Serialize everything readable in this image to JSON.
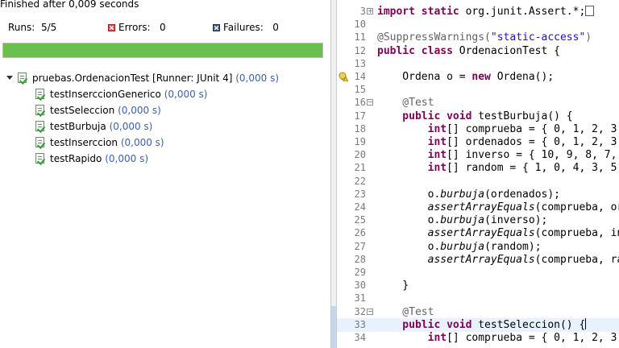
{
  "junit": {
    "status": "Finished after 0,009 seconds",
    "runs_label": "Runs:",
    "runs_value": "5/5",
    "errors_label": "Errors:",
    "errors_value": "0",
    "failures_label": "Failures:",
    "failures_value": "0",
    "progress_fraction": 1.0,
    "progress_color": "#6bbf4e",
    "suite": {
      "name": "pruebas.OrdenacionTest [Runner: JUnit 4]",
      "time": "(0,000 s)",
      "icon": "suite-success-icon"
    },
    "tests": [
      {
        "name": "testInserccionGenerico",
        "time": "(0,000 s)",
        "icon": "test-success-icon"
      },
      {
        "name": "testSeleccion",
        "time": "(0,000 s)",
        "icon": "test-success-icon"
      },
      {
        "name": "testBurbuja",
        "time": "(0,000 s)",
        "icon": "test-success-icon"
      },
      {
        "name": "testInserccion",
        "time": "(0,000 s)",
        "icon": "test-success-icon"
      },
      {
        "name": "testRapido",
        "time": "(0,000 s)",
        "icon": "test-success-icon"
      }
    ]
  },
  "editor": {
    "lines": [
      {
        "num": "3",
        "fold": "+",
        "parts": [
          [
            "kw",
            "import static"
          ],
          [
            "",
            "org.junit.Assert.*;"
          ]
        ],
        "folded_marker": true
      },
      {
        "num": "10",
        "parts": []
      },
      {
        "num": "11",
        "parts": [
          [
            "ann",
            "@SuppressWarnings("
          ],
          [
            "str",
            "\"static-access\""
          ],
          [
            "ann",
            ")"
          ]
        ]
      },
      {
        "num": "12",
        "parts": [
          [
            "kw",
            "public class"
          ],
          [
            "",
            "OrdenacionTest {"
          ]
        ]
      },
      {
        "num": "13",
        "parts": []
      },
      {
        "num": "14",
        "warning": true,
        "parts": [
          [
            "",
            "    Ordena o = "
          ],
          [
            "kw",
            "new"
          ],
          [
            "",
            " Ordena();"
          ]
        ]
      },
      {
        "num": "15",
        "parts": []
      },
      {
        "num": "16",
        "fold": "−",
        "parts": [
          [
            "ann",
            "    @Test"
          ]
        ]
      },
      {
        "num": "17",
        "parts": [
          [
            "kw",
            "    public void"
          ],
          [
            "",
            " testBurbuja() {"
          ]
        ]
      },
      {
        "num": "18",
        "parts": [
          [
            "kw",
            "        int"
          ],
          [
            "",
            "[] comprueba = { 0, 1, 2, 3,"
          ]
        ]
      },
      {
        "num": "19",
        "parts": [
          [
            "kw",
            "        int"
          ],
          [
            "",
            "[] ordenados = { 0, 1, 2, 3,"
          ]
        ]
      },
      {
        "num": "20",
        "parts": [
          [
            "kw",
            "        int"
          ],
          [
            "",
            "[] inverso = { 10, 9, 8, 7,"
          ]
        ]
      },
      {
        "num": "21",
        "parts": [
          [
            "kw",
            "        int"
          ],
          [
            "",
            "[] random = { 1, 0, 4, 3, 5,"
          ]
        ]
      },
      {
        "num": "22",
        "parts": []
      },
      {
        "num": "23",
        "parts": [
          [
            "",
            "        o."
          ],
          [
            "it",
            "burbuja"
          ],
          [
            "",
            "(ordenados);"
          ]
        ]
      },
      {
        "num": "24",
        "parts": [
          [
            "it",
            "        assertArrayEquals"
          ],
          [
            "",
            "(comprueba, or"
          ]
        ]
      },
      {
        "num": "25",
        "parts": [
          [
            "",
            "        o."
          ],
          [
            "it",
            "burbuja"
          ],
          [
            "",
            "(inverso);"
          ]
        ]
      },
      {
        "num": "26",
        "parts": [
          [
            "it",
            "        assertArrayEquals"
          ],
          [
            "",
            "(comprueba, in"
          ]
        ]
      },
      {
        "num": "27",
        "parts": [
          [
            "",
            "        o."
          ],
          [
            "it",
            "burbuja"
          ],
          [
            "",
            "(random);"
          ]
        ]
      },
      {
        "num": "28",
        "parts": [
          [
            "it",
            "        assertArrayEquals"
          ],
          [
            "",
            "(comprueba, ra"
          ]
        ]
      },
      {
        "num": "29",
        "parts": []
      },
      {
        "num": "30",
        "parts": [
          [
            "",
            "    }"
          ]
        ]
      },
      {
        "num": "31",
        "parts": []
      },
      {
        "num": "32",
        "fold": "−",
        "parts": [
          [
            "ann",
            "    @Test"
          ]
        ]
      },
      {
        "num": "33",
        "current": true,
        "cursor": true,
        "parts": [
          [
            "kw",
            "    public void"
          ],
          [
            "",
            " testSeleccion() {"
          ]
        ]
      },
      {
        "num": "34",
        "parts": [
          [
            "kw",
            "        int"
          ],
          [
            "",
            "[] comprueba = { 0, 1, 2, 3,"
          ]
        ]
      }
    ]
  }
}
